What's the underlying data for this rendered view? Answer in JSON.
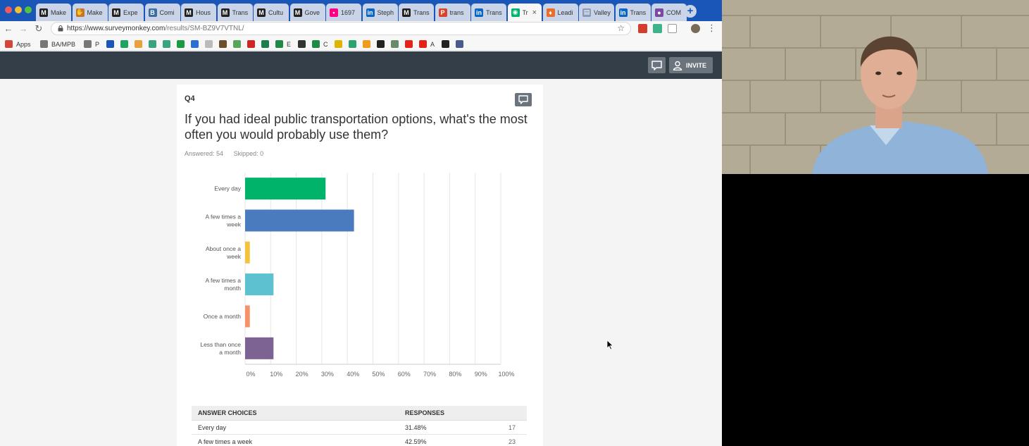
{
  "browser": {
    "tabs": [
      {
        "label": "Make",
        "icon": "medium-icon",
        "color": "#222222",
        "glyph": "M"
      },
      {
        "label": "Make",
        "icon": "hand-icon",
        "color": "#c0762c",
        "glyph": "✋"
      },
      {
        "label": "Expe",
        "icon": "medium-icon",
        "color": "#222222",
        "glyph": "M"
      },
      {
        "label": "Comi",
        "icon": "bold-b-icon",
        "color": "#3a6ea5",
        "glyph": "B"
      },
      {
        "label": "Hous",
        "icon": "medium-icon",
        "color": "#222222",
        "glyph": "M"
      },
      {
        "label": "Trans",
        "icon": "medium-icon",
        "color": "#222222",
        "glyph": "M"
      },
      {
        "label": "Cultu",
        "icon": "medium-icon",
        "color": "#222222",
        "glyph": "M"
      },
      {
        "label": "Gove",
        "icon": "medium-icon",
        "color": "#222222",
        "glyph": "M"
      },
      {
        "label": "1697",
        "icon": "flickr-icon",
        "color": "#ff0084",
        "glyph": "•"
      },
      {
        "label": "Steph",
        "icon": "linkedin-icon",
        "color": "#0a66c2",
        "glyph": "in"
      },
      {
        "label": "Trans",
        "icon": "medium-icon",
        "color": "#222222",
        "glyph": "M"
      },
      {
        "label": "trans",
        "icon": "pdf-icon",
        "color": "#d9432c",
        "glyph": "P"
      },
      {
        "label": "Trans",
        "icon": "linkedin-icon",
        "color": "#0a66c2",
        "glyph": "in"
      },
      {
        "label": "Tr",
        "icon": "surveymonkey-icon",
        "color": "#00b36b",
        "glyph": "◉",
        "active": true
      },
      {
        "label": "Leadi",
        "icon": "fire-icon",
        "color": "#e76f2b",
        "glyph": "♦"
      },
      {
        "label": "Valley",
        "icon": "document-icon",
        "color": "#8a9bb8",
        "glyph": "▤"
      },
      {
        "label": "Trans",
        "icon": "linkedin-icon",
        "color": "#0a66c2",
        "glyph": "in"
      },
      {
        "label": "COM",
        "icon": "circle-logo-icon",
        "color": "#7b4aa0",
        "glyph": "●"
      }
    ],
    "url_host": "https://www.surveymonkey.com",
    "url_path": "/results/SM-BZ9V7VTNL/",
    "bookmarks": [
      {
        "label": "Apps",
        "icon": "apps-grid-icon",
        "color": "#d44638"
      },
      {
        "label": "BA/MPB",
        "icon": "folder-icon",
        "color": "#777777"
      },
      {
        "label": "P",
        "icon": "folder-icon",
        "color": "#777777"
      },
      {
        "label": "",
        "icon": "bookmark-icon",
        "color": "#1a56b8"
      },
      {
        "label": "",
        "icon": "drive-icon",
        "color": "#1fa463"
      },
      {
        "label": "",
        "icon": "bookmark-icon",
        "color": "#e9a13b"
      },
      {
        "label": "",
        "icon": "bookmark-icon",
        "color": "#3aa37f"
      },
      {
        "label": "",
        "icon": "bookmark-icon",
        "color": "#3aa37f"
      },
      {
        "label": "",
        "icon": "bookmark-icon",
        "color": "#1b9a44"
      },
      {
        "label": "",
        "icon": "bookmark-icon",
        "color": "#2a6fd1"
      },
      {
        "label": "",
        "icon": "bookmark-icon",
        "color": "#bbbbbb"
      },
      {
        "label": "",
        "icon": "bookmark-icon",
        "color": "#6b4f2a"
      },
      {
        "label": "",
        "icon": "bookmark-icon",
        "color": "#58a55c"
      },
      {
        "label": "",
        "icon": "bookmark-icon",
        "color": "#d02525"
      },
      {
        "label": "",
        "icon": "bookmark-icon",
        "color": "#1e7d4d"
      },
      {
        "label": "E",
        "icon": "sheets-icon",
        "color": "#1f8a45"
      },
      {
        "label": "",
        "icon": "bookmark-icon",
        "color": "#333333"
      },
      {
        "label": "C",
        "icon": "sheets-icon",
        "color": "#1f8a45"
      },
      {
        "label": "",
        "icon": "bookmark-icon",
        "color": "#e0b400"
      },
      {
        "label": "",
        "icon": "bookmark-icon",
        "color": "#2aa36c"
      },
      {
        "label": "",
        "icon": "bookmark-icon",
        "color": "#f29a1b"
      },
      {
        "label": "",
        "icon": "medium-icon",
        "color": "#222222"
      },
      {
        "label": "",
        "icon": "bookmark-icon",
        "color": "#6a8a6a"
      },
      {
        "label": "",
        "icon": "youtube-icon",
        "color": "#e62117"
      },
      {
        "label": "A",
        "icon": "youtube-icon",
        "color": "#e62117"
      },
      {
        "label": "",
        "icon": "bookmark-icon",
        "color": "#222222"
      },
      {
        "label": "",
        "icon": "bookmark-icon",
        "color": "#4a5a8a"
      }
    ]
  },
  "header": {
    "invite_label": "INVITE"
  },
  "question": {
    "number": "Q4",
    "title": "If you had ideal public transportation options, what's the most often you would probably use them?",
    "answered": "Answered: 54",
    "skipped": "Skipped: 0"
  },
  "chart_data": {
    "type": "bar",
    "orientation": "horizontal",
    "categories": [
      [
        "Every day"
      ],
      [
        "A few times a",
        "week"
      ],
      [
        "About once a",
        "week"
      ],
      [
        "A few times a",
        "month"
      ],
      [
        "Once a month"
      ],
      [
        "Less than once",
        "a month"
      ]
    ],
    "values": [
      31.48,
      42.59,
      1.85,
      11.11,
      1.85,
      11.11
    ],
    "colors": [
      "#00b36b",
      "#4a7bbf",
      "#f5c33b",
      "#5dc1cf",
      "#f5926a",
      "#7d6294"
    ],
    "xlim": [
      0,
      100
    ],
    "xticks": [
      "0%",
      "10%",
      "20%",
      "30%",
      "40%",
      "50%",
      "60%",
      "70%",
      "80%",
      "90%",
      "100%"
    ],
    "grid": true
  },
  "table": {
    "headers": [
      "ANSWER CHOICES",
      "RESPONSES",
      ""
    ],
    "rows": [
      [
        "Every day",
        "31.48%",
        "17"
      ],
      [
        "A few times a week",
        "42.59%",
        "23"
      ]
    ]
  }
}
